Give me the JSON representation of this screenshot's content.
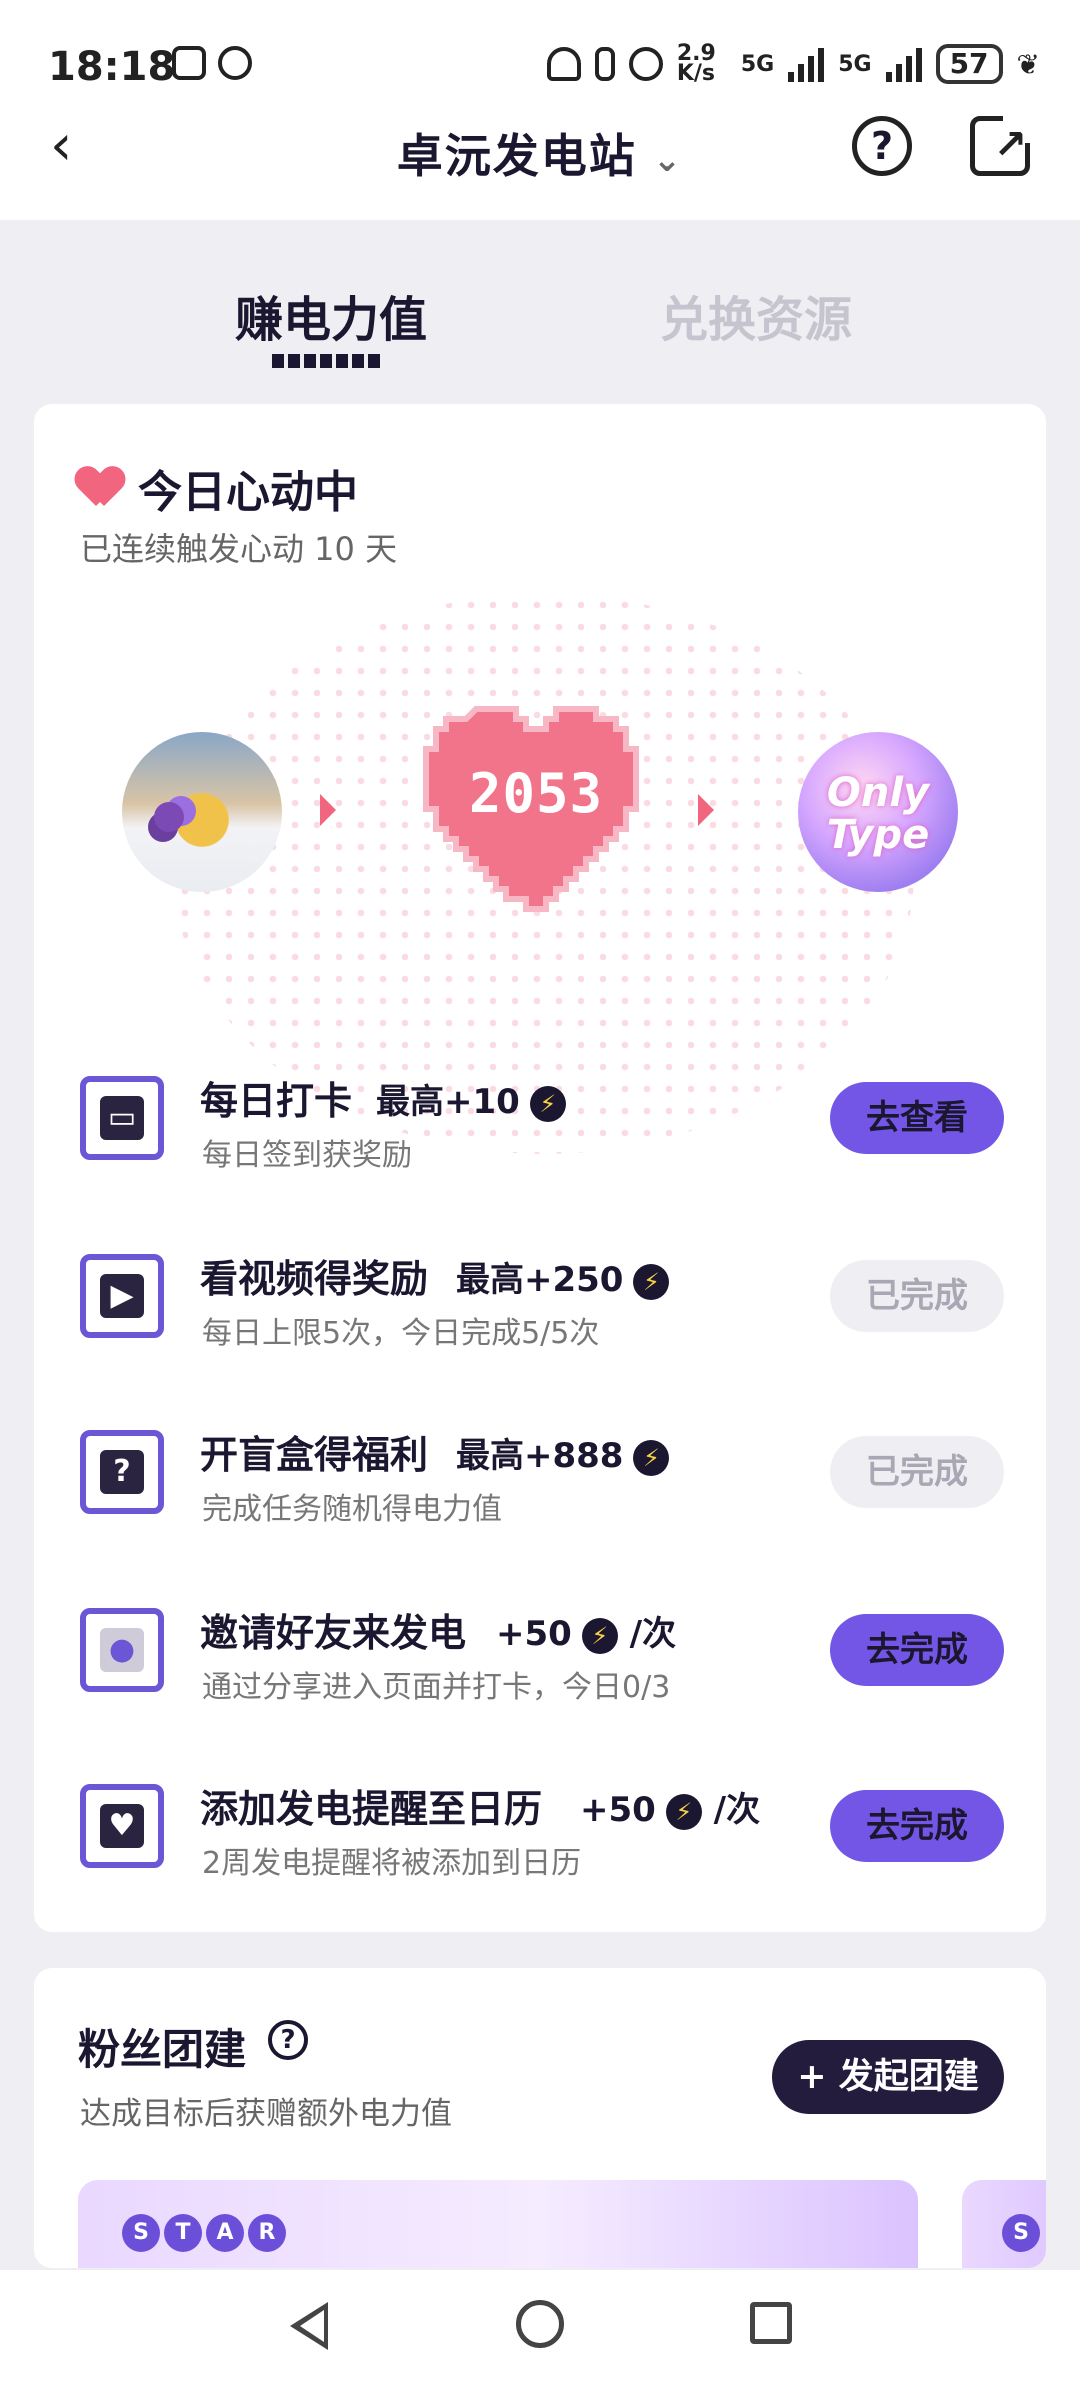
{
  "status_bar": {
    "time": "18:18",
    "net_speed": "2.9 K/s",
    "signal1": "5G",
    "signal2": "5G",
    "battery": "57"
  },
  "header": {
    "title": "卓沅发电站",
    "help_label": "?"
  },
  "tabs": [
    {
      "label": "赚电力值",
      "active": true
    },
    {
      "label": "兑换资源",
      "active": false
    }
  ],
  "heartbeat": {
    "title": "今日心动中",
    "subtitle": "已连续触发心动 10 天",
    "count": "2053",
    "right_avatar_text": "Only Type"
  },
  "tasks": [
    {
      "name": "每日打卡",
      "bonus": "最高+10",
      "suffix": "",
      "desc": "每日签到获奖励",
      "button": "去查看",
      "state": "active",
      "icon": "ticket-icon"
    },
    {
      "name": "看视频得奖励",
      "bonus": "最高+250",
      "suffix": "",
      "desc": "每日上限5次，今日完成5/5次",
      "button": "已完成",
      "state": "done",
      "icon": "video-icon"
    },
    {
      "name": "开盲盒得福利",
      "bonus": "最高+888",
      "suffix": "",
      "desc": "完成任务随机得电力值",
      "button": "已完成",
      "state": "done",
      "icon": "mystery-box-icon"
    },
    {
      "name": "邀请好友来发电",
      "bonus": "+50",
      "suffix": "/次",
      "desc": "通过分享进入页面并打卡，今日0/3",
      "button": "去完成",
      "state": "active",
      "icon": "friends-icon"
    },
    {
      "name": "添加发电提醒至日历",
      "bonus": "+50",
      "suffix": "/次",
      "desc": "2周发电提醒将被添加到日历",
      "button": "去完成",
      "state": "active",
      "icon": "calendar-icon"
    }
  ],
  "fan_group": {
    "title": "粉丝团建",
    "subtitle": "达成目标后获赠额外电力值",
    "button": "+ 发起团建",
    "banner_letters": [
      "S",
      "T",
      "A",
      "R"
    ]
  },
  "colors": {
    "accent": "#7456e6",
    "heart": "#f2657f",
    "dark": "#1b1730"
  }
}
